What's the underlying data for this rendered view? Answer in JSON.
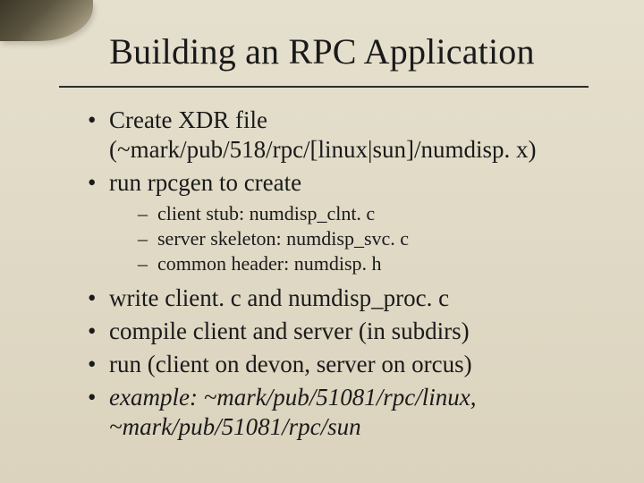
{
  "title": "Building an RPC Application",
  "bullets": {
    "b1": "Create XDR file (~mark/pub/518/rpc/[linux|sun]/numdisp. x)",
    "b2": "run rpcgen to create",
    "sub1": "client stub: numdisp_clnt. c",
    "sub2": "server skeleton: numdisp_svc. c",
    "sub3": "common header: numdisp. h",
    "b3": "write client. c and numdisp_proc. c",
    "b4": "compile client and server (in subdirs)",
    "b5": "run (client on devon, server on orcus)",
    "b6": "example:  ~mark/pub/51081/rpc/linux, ~mark/pub/51081/rpc/sun"
  }
}
